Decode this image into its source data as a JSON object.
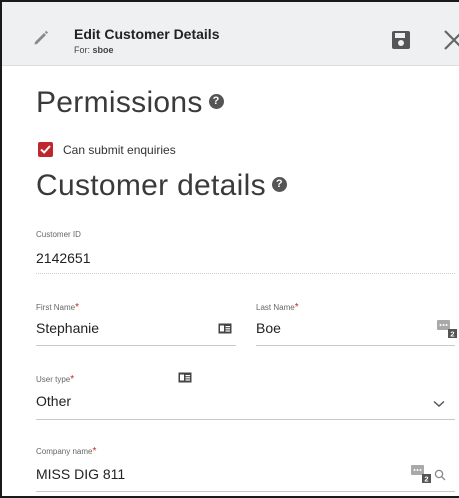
{
  "header": {
    "title": "Edit Customer Details",
    "subtitle_prefix": "For:",
    "subtitle_user": "sboe",
    "icons": [
      "pencil-icon",
      "save-icon",
      "close-icon"
    ]
  },
  "permissions": {
    "heading": "Permissions",
    "can_submit_enquiries": {
      "label": "Can submit enquiries",
      "checked": true
    }
  },
  "customer_details": {
    "heading": "Customer details",
    "customer_id": {
      "label": "Customer ID",
      "value": "2142651"
    },
    "first_name": {
      "label": "First Name",
      "required_mark": "*",
      "value": "Stephanie"
    },
    "last_name": {
      "label": "Last Name",
      "required_mark": "*",
      "value": "Boe"
    },
    "user_type": {
      "label": "User type",
      "required_mark": "*",
      "value": "Other"
    },
    "company_name": {
      "label": "Company name",
      "required_mark": "*",
      "value": "MISS DIG 811"
    },
    "lookup_badge": "2"
  },
  "colors": {
    "accent_red": "#c0272d",
    "header_bg": "#eef0f1",
    "text_dark": "#222222"
  }
}
